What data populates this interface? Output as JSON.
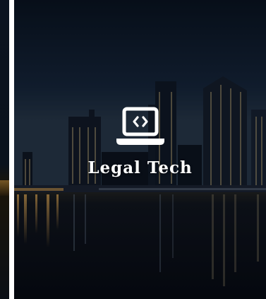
{
  "card": {
    "title": "Legal Tech",
    "icon": "laptop-code-icon"
  },
  "colors": {
    "sky_top": "#0b1622",
    "sky_mid": "#1f2d3d",
    "water": "#06090d",
    "accent_lights": "#d8a24a",
    "text": "#ffffff"
  }
}
